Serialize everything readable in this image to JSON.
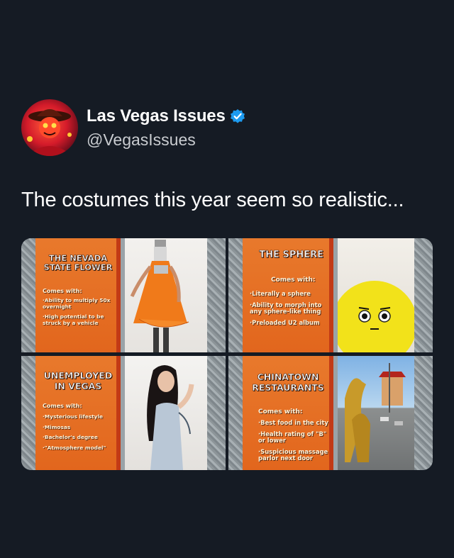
{
  "author": {
    "display_name": "Las Vegas Issues",
    "handle": "@VegasIssues"
  },
  "tweet": {
    "text": "The costumes this year seem so realistic..."
  },
  "media": [
    {
      "title": "THE NEVADA STATE FLOWER",
      "comes_with": "Comes with:",
      "bullets": [
        "·Ability to multiply 50x overnight",
        "·High potential to be struck by a vehicle"
      ]
    },
    {
      "title": "THE SPHERE",
      "comes_with": "Comes with:",
      "bullets": [
        "·Literally a sphere",
        "·Ability to morph into any sphere-like thing",
        "·Preloaded U2 album"
      ]
    },
    {
      "title": "UNEMPLOYED IN VEGAS",
      "comes_with": "Comes with:",
      "bullets": [
        "·Mysterious lifestyle",
        "·Mimosas",
        "·Bachelor's degree",
        "·\"Atmosphere model\""
      ]
    },
    {
      "title": "CHINATOWN RESTAURANTS",
      "comes_with": "Comes with:",
      "bullets": [
        "·Best food in the city",
        "·Health rating of \"B\" or lower",
        "·Suspicious massage parlor next door"
      ]
    }
  ],
  "colors": {
    "background": "#151b24",
    "verified": "#1d9bf0",
    "sign_orange": "#e2661d",
    "sign_stripe": "#c23a16"
  },
  "icons": {
    "verified": "verified-badge-icon"
  }
}
